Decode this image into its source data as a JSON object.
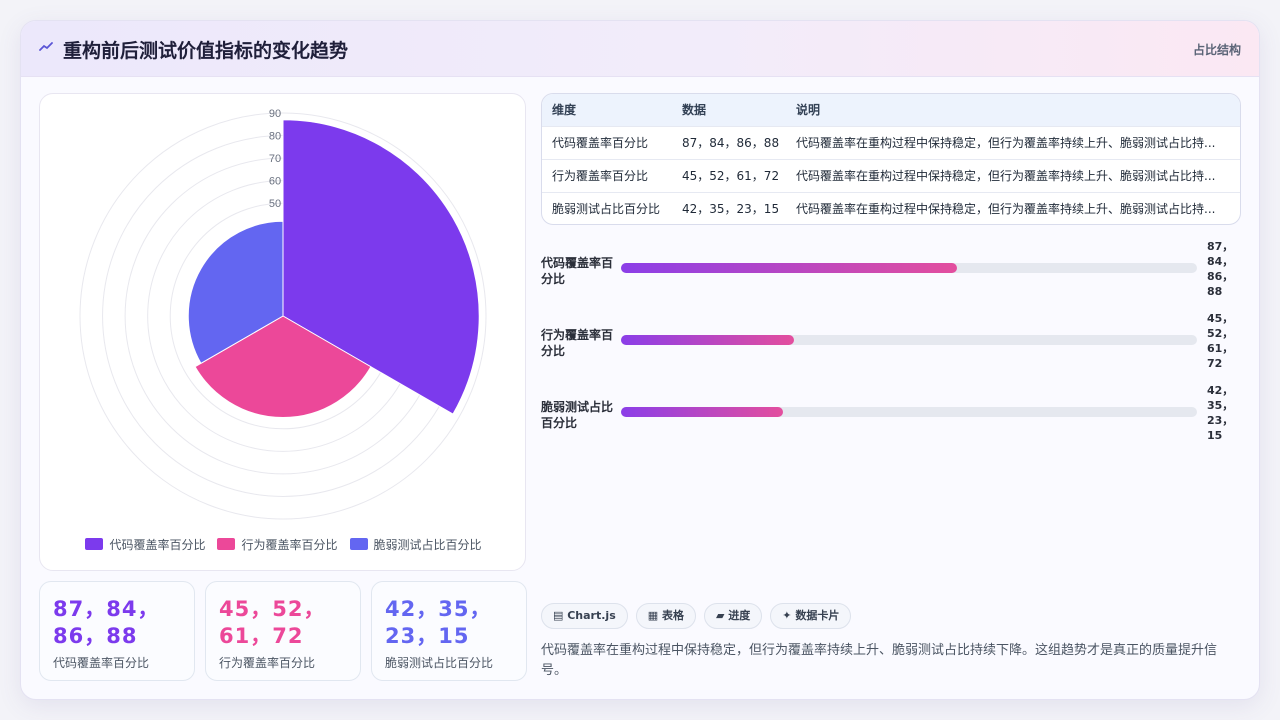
{
  "header": {
    "icon": "trend-line-icon",
    "title": "重构前后测试价值指标的变化趋势",
    "right_label": "占比结构"
  },
  "chart_data": {
    "type": "polarArea",
    "radial_axis": {
      "min": 0,
      "max": 90,
      "ticks": [
        10,
        20,
        30,
        40,
        50,
        60,
        70,
        80,
        90
      ]
    },
    "categories": [
      "代码覆盖率百分比",
      "行为覆盖率百分比",
      "脆弱测试占比百分比"
    ],
    "values": [
      87,
      45,
      42
    ],
    "colors": [
      "#7c3aed",
      "#ec4899",
      "#6366f1"
    ],
    "legend": "bottom",
    "grid": true
  },
  "stats": [
    {
      "value": "87，84，86，88",
      "label": "代码覆盖率百分比",
      "color": "#7c3aed"
    },
    {
      "value": "45，52，61，72",
      "label": "行为覆盖率百分比",
      "color": "#ec4899"
    },
    {
      "value": "42，35，23，15",
      "label": "脆弱测试占比百分比",
      "color": "#6366f1"
    }
  ],
  "table": {
    "headers": [
      "维度",
      "数据",
      "说明"
    ],
    "rows": [
      [
        "代码覆盖率百分比",
        "87，84，86，88",
        "代码覆盖率在重构过程中保持稳定，但行为覆盖率持续上升、脆弱测试占比持..."
      ],
      [
        "行为覆盖率百分比",
        "45，52，61，72",
        "代码覆盖率在重构过程中保持稳定，但行为覆盖率持续上升、脆弱测试占比持..."
      ],
      [
        "脆弱测试占比百分比",
        "42，35，23，15",
        "代码覆盖率在重构过程中保持稳定，但行为覆盖率持续上升、脆弱测试占比持..."
      ]
    ]
  },
  "progress": [
    {
      "label": "代码覆盖率百分比",
      "value": "87，84，86，88",
      "fraction": 0.583
    },
    {
      "label": "行为覆盖率百分比",
      "value": "45，52，61，72",
      "fraction": 0.301
    },
    {
      "label": "脆弱测试占比百分比",
      "value": "42，35，23，15",
      "fraction": 0.281
    }
  ],
  "tags": [
    {
      "icon": "chart-icon",
      "label": "Chart.js"
    },
    {
      "icon": "table-icon",
      "label": "表格"
    },
    {
      "icon": "progress-icon",
      "label": "进度"
    },
    {
      "icon": "sparkle-icon",
      "label": "数据卡片"
    }
  ],
  "summary": "代码覆盖率在重构过程中保持稳定，但行为覆盖率持续上升、脆弱测试占比持续下降。这组趋势才是真正的质量提升信号。"
}
